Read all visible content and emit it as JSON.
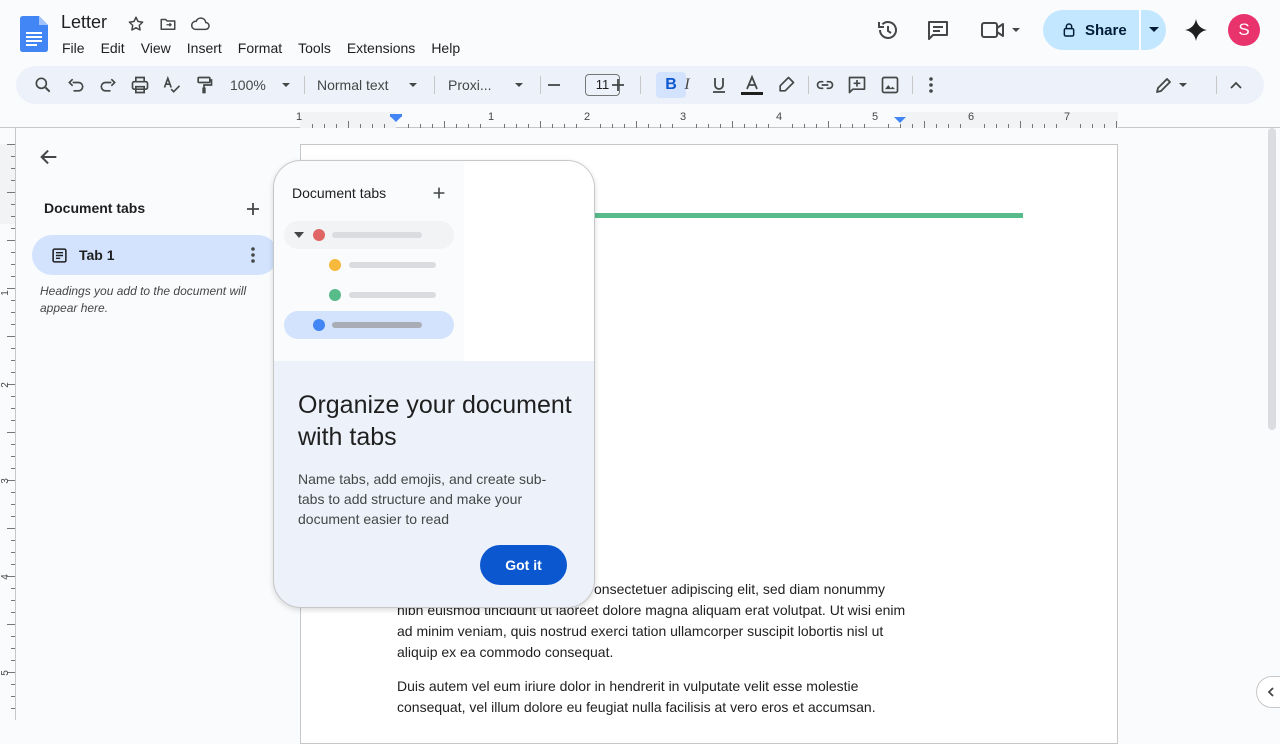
{
  "header": {
    "doc_title": "Letter",
    "menu": [
      "File",
      "Edit",
      "View",
      "Insert",
      "Format",
      "Tools",
      "Extensions",
      "Help"
    ],
    "share_label": "Share",
    "avatar_initial": "S",
    "icons": [
      "docs-logo-icon",
      "star-icon",
      "move-folder-icon",
      "cloud-status-icon",
      "history-icon",
      "comment-icon",
      "video-call-icon",
      "gemini-icon"
    ]
  },
  "toolbar": {
    "zoom": "100%",
    "style": "Normal text",
    "font": "Proxi...",
    "font_size": "11",
    "bold_active": true
  },
  "ruler": {
    "labels": [
      "1",
      "1",
      "2",
      "3",
      "4",
      "5",
      "6",
      "7"
    ]
  },
  "left_panel": {
    "title": "Document tabs",
    "tabs": [
      {
        "label": "Tab 1"
      }
    ],
    "hint": "Headings you add to the document will appear here."
  },
  "popup": {
    "illustration_title": "Document tabs",
    "heading": "Organize your document with tabs",
    "body": "Name tabs, add emojis, and create sub-tabs to add structure and make your document easier to read",
    "button_label": "Got it",
    "dot_colors": [
      "#e06666",
      "#f6b93b",
      "#57bb8a",
      "#4285f4"
    ]
  },
  "document": {
    "para1_line1": "onsectetuer adipiscing elit, sed diam nonummy",
    "para1_rest": "nibh euismod tincidunt ut laoreet dolore magna aliquam erat volutpat. Ut wisi enim ad minim veniam, quis nostrud exerci tation ullamcorper suscipit lobortis nisl ut aliquip ex ea commodo consequat.",
    "para2": "Duis autem vel eum iriure dolor in hendrerit in vulputate velit esse molestie consequat, vel illum dolore eu feugiat nulla facilisis at vero eros et accumsan."
  },
  "colors": {
    "accent": "#0b57d0",
    "share_bg": "#c2e7ff",
    "avatar": "#e8336d",
    "heading_rule": "#57bb8a"
  }
}
